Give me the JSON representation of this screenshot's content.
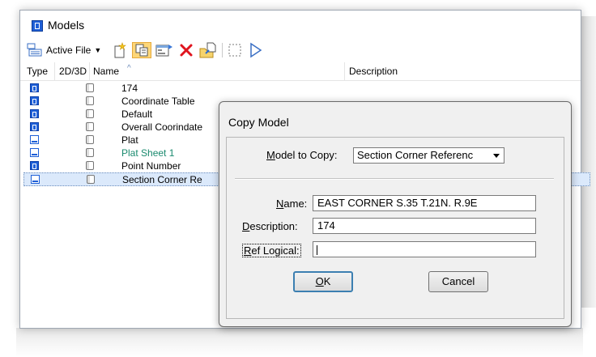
{
  "window": {
    "title": "Models"
  },
  "toolbar": {
    "file_source": "Active File",
    "icons": [
      "create-model-icon",
      "copy-model-icon",
      "model-properties-icon",
      "delete-icon",
      "import-icon",
      "select-all-icon",
      "set-active-icon"
    ]
  },
  "list": {
    "headers": {
      "type": "Type",
      "dim": "2D/3D",
      "name": "Name",
      "description": "Description"
    },
    "rows": [
      {
        "type": "design",
        "name": "174",
        "name_color": "#000000"
      },
      {
        "type": "design",
        "name": "Coordinate Table",
        "name_color": "#000000"
      },
      {
        "type": "design",
        "name": "Default",
        "name_color": "#000000"
      },
      {
        "type": "design",
        "name": "Overall Coorindate",
        "name_color": "#000000"
      },
      {
        "type": "sheet",
        "name": "Plat",
        "name_color": "#000000"
      },
      {
        "type": "sheet",
        "name": "Plat Sheet 1",
        "name_color": "#1a8a6e"
      },
      {
        "type": "design",
        "name": "Point Number",
        "name_color": "#000000"
      },
      {
        "type": "sheet",
        "name": "Section Corner Re",
        "name_color": "#000000",
        "selected": true
      }
    ]
  },
  "dialog": {
    "title": "Copy Model",
    "model_to_copy_label": "Model to Copy:",
    "model_to_copy_value": "Section Corner Referenc",
    "name_label": "Name:",
    "name_value": "EAST CORNER S.35 T.21N. R.9E",
    "description_label": "Description:",
    "description_value": "174",
    "ref_logical_label": "Ref Logical:",
    "ref_logical_value": "",
    "ok_label": "OK",
    "cancel_label": "Cancel"
  }
}
